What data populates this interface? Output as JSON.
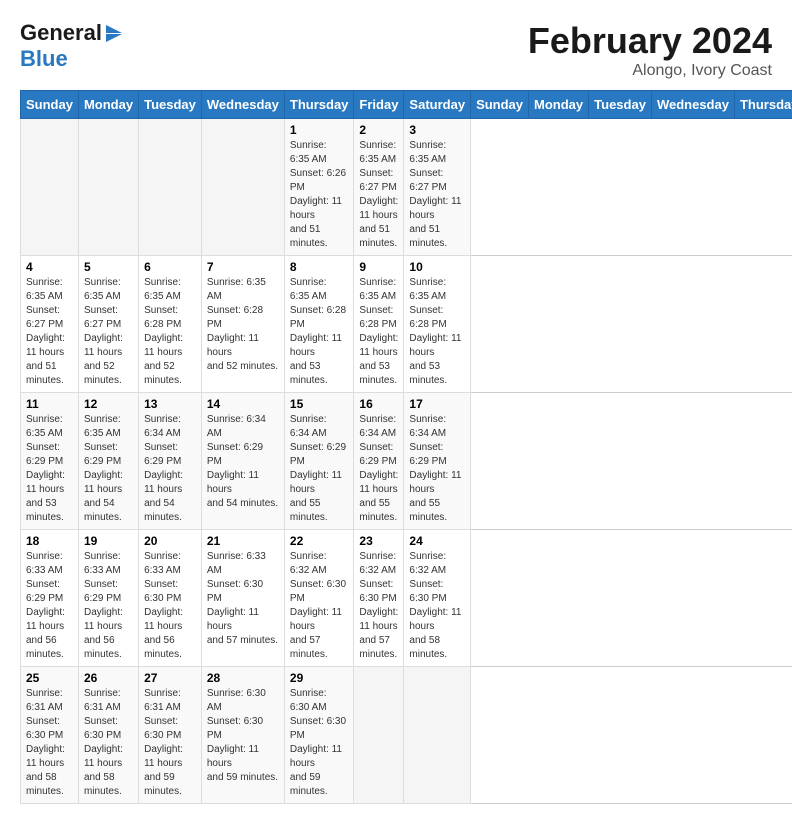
{
  "logo": {
    "line1": "General",
    "line2": "Blue"
  },
  "title": "February 2024",
  "location": "Alongo, Ivory Coast",
  "days_of_week": [
    "Sunday",
    "Monday",
    "Tuesday",
    "Wednesday",
    "Thursday",
    "Friday",
    "Saturday"
  ],
  "weeks": [
    [
      {
        "day": "",
        "info": ""
      },
      {
        "day": "",
        "info": ""
      },
      {
        "day": "",
        "info": ""
      },
      {
        "day": "",
        "info": ""
      },
      {
        "day": "1",
        "info": "Sunrise: 6:35 AM\nSunset: 6:26 PM\nDaylight: 11 hours\nand 51 minutes."
      },
      {
        "day": "2",
        "info": "Sunrise: 6:35 AM\nSunset: 6:27 PM\nDaylight: 11 hours\nand 51 minutes."
      },
      {
        "day": "3",
        "info": "Sunrise: 6:35 AM\nSunset: 6:27 PM\nDaylight: 11 hours\nand 51 minutes."
      }
    ],
    [
      {
        "day": "4",
        "info": "Sunrise: 6:35 AM\nSunset: 6:27 PM\nDaylight: 11 hours\nand 51 minutes."
      },
      {
        "day": "5",
        "info": "Sunrise: 6:35 AM\nSunset: 6:27 PM\nDaylight: 11 hours\nand 52 minutes."
      },
      {
        "day": "6",
        "info": "Sunrise: 6:35 AM\nSunset: 6:28 PM\nDaylight: 11 hours\nand 52 minutes."
      },
      {
        "day": "7",
        "info": "Sunrise: 6:35 AM\nSunset: 6:28 PM\nDaylight: 11 hours\nand 52 minutes."
      },
      {
        "day": "8",
        "info": "Sunrise: 6:35 AM\nSunset: 6:28 PM\nDaylight: 11 hours\nand 53 minutes."
      },
      {
        "day": "9",
        "info": "Sunrise: 6:35 AM\nSunset: 6:28 PM\nDaylight: 11 hours\nand 53 minutes."
      },
      {
        "day": "10",
        "info": "Sunrise: 6:35 AM\nSunset: 6:28 PM\nDaylight: 11 hours\nand 53 minutes."
      }
    ],
    [
      {
        "day": "11",
        "info": "Sunrise: 6:35 AM\nSunset: 6:29 PM\nDaylight: 11 hours\nand 53 minutes."
      },
      {
        "day": "12",
        "info": "Sunrise: 6:35 AM\nSunset: 6:29 PM\nDaylight: 11 hours\nand 54 minutes."
      },
      {
        "day": "13",
        "info": "Sunrise: 6:34 AM\nSunset: 6:29 PM\nDaylight: 11 hours\nand 54 minutes."
      },
      {
        "day": "14",
        "info": "Sunrise: 6:34 AM\nSunset: 6:29 PM\nDaylight: 11 hours\nand 54 minutes."
      },
      {
        "day": "15",
        "info": "Sunrise: 6:34 AM\nSunset: 6:29 PM\nDaylight: 11 hours\nand 55 minutes."
      },
      {
        "day": "16",
        "info": "Sunrise: 6:34 AM\nSunset: 6:29 PM\nDaylight: 11 hours\nand 55 minutes."
      },
      {
        "day": "17",
        "info": "Sunrise: 6:34 AM\nSunset: 6:29 PM\nDaylight: 11 hours\nand 55 minutes."
      }
    ],
    [
      {
        "day": "18",
        "info": "Sunrise: 6:33 AM\nSunset: 6:29 PM\nDaylight: 11 hours\nand 56 minutes."
      },
      {
        "day": "19",
        "info": "Sunrise: 6:33 AM\nSunset: 6:29 PM\nDaylight: 11 hours\nand 56 minutes."
      },
      {
        "day": "20",
        "info": "Sunrise: 6:33 AM\nSunset: 6:30 PM\nDaylight: 11 hours\nand 56 minutes."
      },
      {
        "day": "21",
        "info": "Sunrise: 6:33 AM\nSunset: 6:30 PM\nDaylight: 11 hours\nand 57 minutes."
      },
      {
        "day": "22",
        "info": "Sunrise: 6:32 AM\nSunset: 6:30 PM\nDaylight: 11 hours\nand 57 minutes."
      },
      {
        "day": "23",
        "info": "Sunrise: 6:32 AM\nSunset: 6:30 PM\nDaylight: 11 hours\nand 57 minutes."
      },
      {
        "day": "24",
        "info": "Sunrise: 6:32 AM\nSunset: 6:30 PM\nDaylight: 11 hours\nand 58 minutes."
      }
    ],
    [
      {
        "day": "25",
        "info": "Sunrise: 6:31 AM\nSunset: 6:30 PM\nDaylight: 11 hours\nand 58 minutes."
      },
      {
        "day": "26",
        "info": "Sunrise: 6:31 AM\nSunset: 6:30 PM\nDaylight: 11 hours\nand 58 minutes."
      },
      {
        "day": "27",
        "info": "Sunrise: 6:31 AM\nSunset: 6:30 PM\nDaylight: 11 hours\nand 59 minutes."
      },
      {
        "day": "28",
        "info": "Sunrise: 6:30 AM\nSunset: 6:30 PM\nDaylight: 11 hours\nand 59 minutes."
      },
      {
        "day": "29",
        "info": "Sunrise: 6:30 AM\nSunset: 6:30 PM\nDaylight: 11 hours\nand 59 minutes."
      },
      {
        "day": "",
        "info": ""
      },
      {
        "day": "",
        "info": ""
      }
    ]
  ]
}
